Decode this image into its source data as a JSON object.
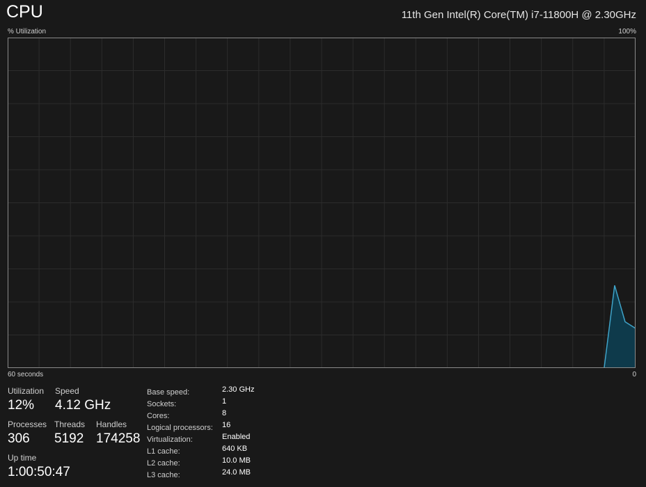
{
  "header": {
    "title": "CPU",
    "cpu_name": "11th Gen Intel(R) Core(TM) i7-11800H @ 2.30GHz"
  },
  "graph": {
    "y_label": "% Utilization",
    "y_max_label": "100%",
    "x_left_label": "60 seconds",
    "x_right_label": "0"
  },
  "chart_data": {
    "type": "area",
    "title": "% Utilization",
    "xlabel": "seconds",
    "ylim": [
      0,
      100
    ],
    "xlim": [
      60,
      0
    ],
    "grid": true,
    "x_seconds_ago": [
      3,
      2,
      1,
      0
    ],
    "values": [
      0,
      25,
      14,
      12
    ],
    "note_earlier_values": 0,
    "line_color": "#3fa3c8",
    "fill_color": "#0e3a4b"
  },
  "stats": {
    "utilization": {
      "label": "Utilization",
      "value": "12%"
    },
    "speed": {
      "label": "Speed",
      "value": "4.12 GHz"
    },
    "processes": {
      "label": "Processes",
      "value": "306"
    },
    "threads": {
      "label": "Threads",
      "value": "5192"
    },
    "handles": {
      "label": "Handles",
      "value": "174258"
    },
    "uptime": {
      "label": "Up time",
      "value": "1:00:50:47"
    }
  },
  "details": [
    {
      "k": "Base speed:",
      "v": "2.30 GHz"
    },
    {
      "k": "Sockets:",
      "v": "1"
    },
    {
      "k": "Cores:",
      "v": "8"
    },
    {
      "k": "Logical processors:",
      "v": "16"
    },
    {
      "k": "Virtualization:",
      "v": "Enabled"
    },
    {
      "k": "L1 cache:",
      "v": "640 KB"
    },
    {
      "k": "L2 cache:",
      "v": "10.0 MB"
    },
    {
      "k": "L3 cache:",
      "v": "24.0 MB"
    }
  ]
}
